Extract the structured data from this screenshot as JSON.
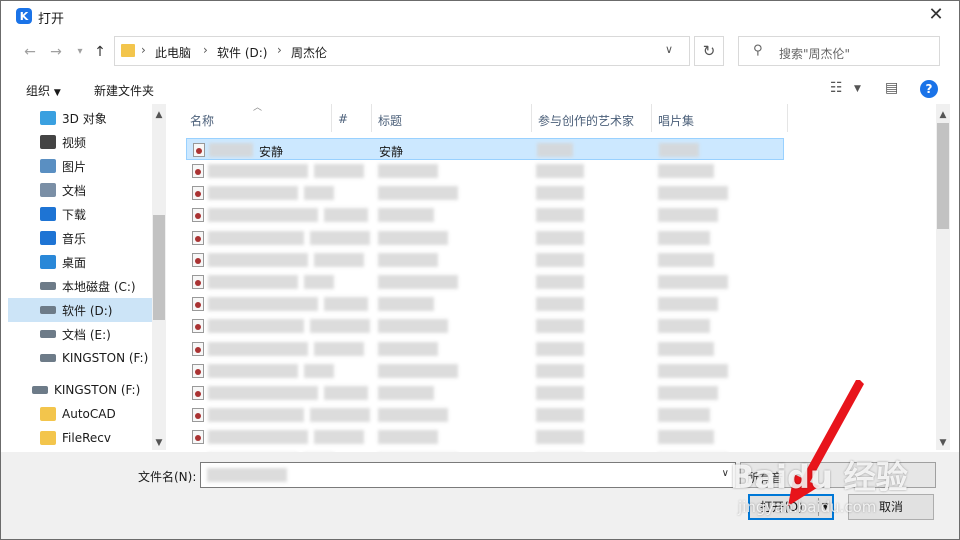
{
  "window": {
    "title": "打开",
    "app_icon_letter": "K"
  },
  "address": {
    "breadcrumbs": [
      "此电脑",
      "软件 (D:)",
      "周杰伦"
    ]
  },
  "search": {
    "placeholder": "搜索\"周杰伦\""
  },
  "toolbar": {
    "organize": "组织",
    "new_folder": "新建文件夹"
  },
  "sidebar": {
    "items": [
      {
        "label": "3D 对象",
        "icon": "3d-objects-icon",
        "color": "#3aa0e0"
      },
      {
        "label": "视频",
        "icon": "video-icon",
        "color": "#444444"
      },
      {
        "label": "图片",
        "icon": "pictures-icon",
        "color": "#5a8fc2"
      },
      {
        "label": "文档",
        "icon": "documents-icon",
        "color": "#7a8fa6"
      },
      {
        "label": "下载",
        "icon": "download-icon",
        "color": "#1e74d4"
      },
      {
        "label": "音乐",
        "icon": "music-icon",
        "color": "#1e74d4"
      },
      {
        "label": "桌面",
        "icon": "desktop-icon",
        "color": "#2a88d8"
      },
      {
        "label": "本地磁盘 (C:)",
        "icon": "drive-icon",
        "color": "#6d7b88"
      },
      {
        "label": "软件 (D:)",
        "icon": "drive-icon",
        "color": "#6d7b88",
        "selected": true
      },
      {
        "label": "文档 (E:)",
        "icon": "drive-icon",
        "color": "#6d7b88"
      },
      {
        "label": "KINGSTON (F:)",
        "icon": "usb-drive-icon",
        "color": "#6d7b88"
      },
      {
        "label": "KINGSTON (F:)",
        "icon": "usb-drive-icon",
        "color": "#6d7b88"
      },
      {
        "label": "AutoCAD",
        "icon": "folder-icon",
        "color": "#f3c54c"
      },
      {
        "label": "FileRecv",
        "icon": "folder-icon",
        "color": "#f3c54c"
      }
    ]
  },
  "file_list": {
    "columns": [
      "名称",
      "#",
      "标题",
      "参与创作的艺术家",
      "唱片集"
    ],
    "rows": [
      {
        "name": "安静",
        "title": "安静",
        "selected": true
      }
    ],
    "blurred_row_count": 14
  },
  "footer": {
    "filename_label": "文件名(N):",
    "type_partial": "所有音",
    "open_button": "打开(O)",
    "cancel_button": "取消"
  },
  "watermark": {
    "main": "Baidu 经验",
    "sub": "jingyan.baidu.com"
  }
}
